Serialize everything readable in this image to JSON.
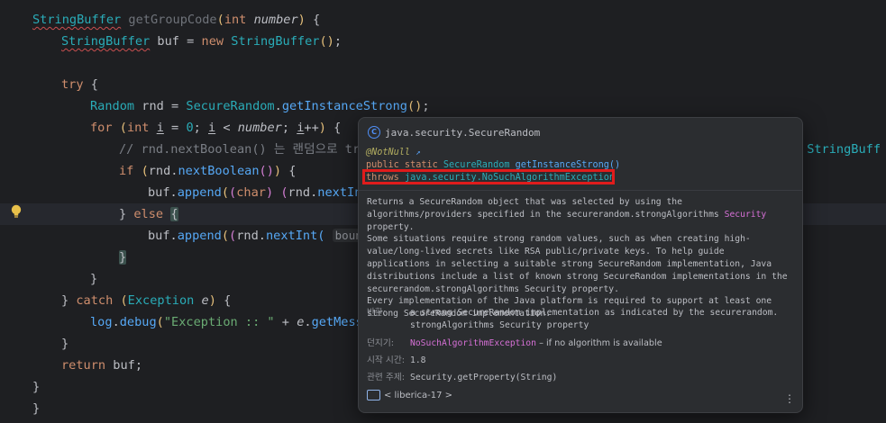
{
  "code_lines": [
    {
      "indent": "",
      "parts": [
        [
          "StringBuffer",
          "ty typo"
        ],
        [
          " ",
          "ok"
        ],
        [
          "getGroupCode",
          "dim"
        ],
        [
          "(",
          "paren1"
        ],
        [
          "int",
          "kw"
        ],
        [
          " ",
          "ok"
        ],
        [
          "number",
          "par"
        ],
        [
          ")",
          "paren1"
        ],
        [
          " {",
          "ok"
        ]
      ]
    },
    {
      "indent": "    ",
      "parts": [
        [
          "StringBuffer",
          "ty typo"
        ],
        [
          " buf = ",
          "ok"
        ],
        [
          "new",
          "kw"
        ],
        [
          " ",
          "ok"
        ],
        [
          "StringBuffer",
          "ty"
        ],
        [
          "()",
          "paren1"
        ],
        [
          ";",
          "ok"
        ]
      ]
    },
    {
      "indent": "",
      "parts": []
    },
    {
      "indent": "    ",
      "parts": [
        [
          "try",
          "kw"
        ],
        [
          " {",
          "ok"
        ]
      ]
    },
    {
      "indent": "        ",
      "parts": [
        [
          "Random",
          "ty"
        ],
        [
          " rnd = ",
          "ok"
        ],
        [
          "SecureRandom",
          "ty"
        ],
        [
          ".",
          "ok"
        ],
        [
          "getInstanceStrong",
          "fn"
        ],
        [
          "()",
          "paren1"
        ],
        [
          ";",
          "ok"
        ]
      ]
    },
    {
      "indent": "        ",
      "parts": [
        [
          "for",
          "kw"
        ],
        [
          " ",
          "ok"
        ],
        [
          "(",
          "paren1"
        ],
        [
          "int",
          "kw"
        ],
        [
          " ",
          "ok"
        ],
        [
          "i",
          "under var"
        ],
        [
          " = ",
          "ok"
        ],
        [
          "0",
          "ty"
        ],
        [
          "; ",
          "ok"
        ],
        [
          "i",
          "under var"
        ],
        [
          " < ",
          "ok"
        ],
        [
          "number",
          "par"
        ],
        [
          "; ",
          "ok"
        ],
        [
          "i",
          "under var"
        ],
        [
          "++",
          "ok"
        ],
        [
          ")",
          "paren1"
        ],
        [
          " {",
          "ok"
        ]
      ]
    },
    {
      "indent": "            ",
      "parts": [
        [
          "// rnd.nextBoolean() 는 랜덤으로 tru",
          "cm"
        ]
      ]
    },
    {
      "indent": "            ",
      "parts": [
        [
          "if",
          "kw"
        ],
        [
          " ",
          "ok"
        ],
        [
          "(",
          "paren1"
        ],
        [
          "rnd.",
          "ok"
        ],
        [
          "nextBoolean",
          "fn"
        ],
        [
          "()",
          "paren2"
        ],
        [
          ")",
          "paren1"
        ],
        [
          " {",
          "ok"
        ]
      ]
    },
    {
      "indent": "                ",
      "parts": [
        [
          "buf.",
          "ok"
        ],
        [
          "append",
          "fn"
        ],
        [
          "(",
          "paren1"
        ],
        [
          "(",
          "paren2"
        ],
        [
          "char",
          "kw"
        ],
        [
          ")",
          "paren2"
        ],
        [
          " ",
          "ok"
        ],
        [
          "(",
          "paren2"
        ],
        [
          "rnd.",
          "ok"
        ],
        [
          "nextIn",
          "fn"
        ]
      ]
    },
    {
      "indent": "            ",
      "parts": [
        [
          "} ",
          "ok"
        ],
        [
          "else",
          "kw"
        ],
        [
          " ",
          "ok"
        ],
        [
          "{",
          "brace-hl"
        ]
      ]
    },
    {
      "indent": "                ",
      "parts": [
        [
          "buf.",
          "ok"
        ],
        [
          "append",
          "fn"
        ],
        [
          "(",
          "paren1"
        ],
        [
          "(",
          "paren2"
        ],
        [
          "rnd.",
          "ok"
        ],
        [
          "nextInt",
          "fn"
        ],
        [
          "(",
          "paren3"
        ],
        [
          " ",
          "ok"
        ],
        [
          "boun",
          "hint"
        ]
      ]
    },
    {
      "indent": "            ",
      "parts": [
        [
          "}",
          "brace-hl"
        ]
      ]
    },
    {
      "indent": "        ",
      "parts": [
        [
          "}",
          "ok"
        ]
      ]
    },
    {
      "indent": "    ",
      "parts": [
        [
          "} ",
          "ok"
        ],
        [
          "catch",
          "kw"
        ],
        [
          " ",
          "ok"
        ],
        [
          "(",
          "paren1"
        ],
        [
          "Exception",
          "ty"
        ],
        [
          " ",
          "ok"
        ],
        [
          "e",
          "par"
        ],
        [
          ")",
          "paren1"
        ],
        [
          " {",
          "ok"
        ]
      ]
    },
    {
      "indent": "        ",
      "parts": [
        [
          "log",
          "fn"
        ],
        [
          ".",
          "ok"
        ],
        [
          "debug",
          "fn"
        ],
        [
          "(",
          "paren1"
        ],
        [
          "\"Exception :: \"",
          "st"
        ],
        [
          " + ",
          "ok"
        ],
        [
          "e",
          "par"
        ],
        [
          ".",
          "ok"
        ],
        [
          "getMess",
          "fn"
        ]
      ]
    },
    {
      "indent": "    ",
      "parts": [
        [
          "}",
          "ok"
        ]
      ]
    },
    {
      "indent": "    ",
      "parts": [
        [
          "return",
          "kw"
        ],
        [
          " buf;",
          "ok"
        ]
      ]
    },
    {
      "indent": "",
      "parts": [
        [
          "}",
          "ok"
        ]
      ]
    },
    {
      "indent": "",
      "parts": [
        [
          "}",
          "ok"
        ]
      ]
    }
  ],
  "overflow_right_text": "StringBuff",
  "popup": {
    "header": "java.security.SecureRandom",
    "annotation": "@NotNull",
    "annotation_arrow": "↗",
    "sig_line1_mod": "public static ",
    "sig_line1_type": "SecureRandom",
    "sig_line1_method": " getInstanceStrong()",
    "throws_kw": "throws ",
    "throws_type": "java.security.NoSuchAlgorithmException",
    "desc_p1_a": "Returns a SecureRandom object that was selected by using the algorithms/providers specified in the securerandom.strongAlgorithms ",
    "desc_p1_link": "Security",
    "desc_p1_b": " property.",
    "desc_p2": "Some situations require strong random values, such as when creating high-value/long-lived secrets like RSA public/private keys. To help guide applications in selecting a suitable strong SecureRandom implementation, Java distributions include a list of known strong SecureRandom implementations in the securerandom.strongAlgorithms Security property.",
    "desc_p3": "Every implementation of the Java platform is required to support at least one strong SecureRandom implementation.",
    "returns_label": "반환:",
    "returns_value_1": "a strong SecureRandom implementation as indicated by the securerandom.",
    "returns_value_2": "strongAlgorithms Security property",
    "throws_label": "던지기:",
    "throws_value_link": "NoSuchAlgorithmException",
    "throws_value_rest": " – if no algorithm is available",
    "since_label": "시작 시간:",
    "since_value": "1.8",
    "see_label": "관련 주제:",
    "see_value": "Security.getProperty(String)",
    "jdk_label": "< liberica-17 >",
    "more_icon": "⋮"
  },
  "colors": {
    "editor_bg": "#1e1f22",
    "popup_bg": "#2b2d30",
    "highlight_box": "#e01c1c",
    "keyword": "#cf8e6d",
    "type": "#2aacb8",
    "method": "#56a8f5",
    "string": "#6aab73",
    "link": "#d670d6"
  }
}
